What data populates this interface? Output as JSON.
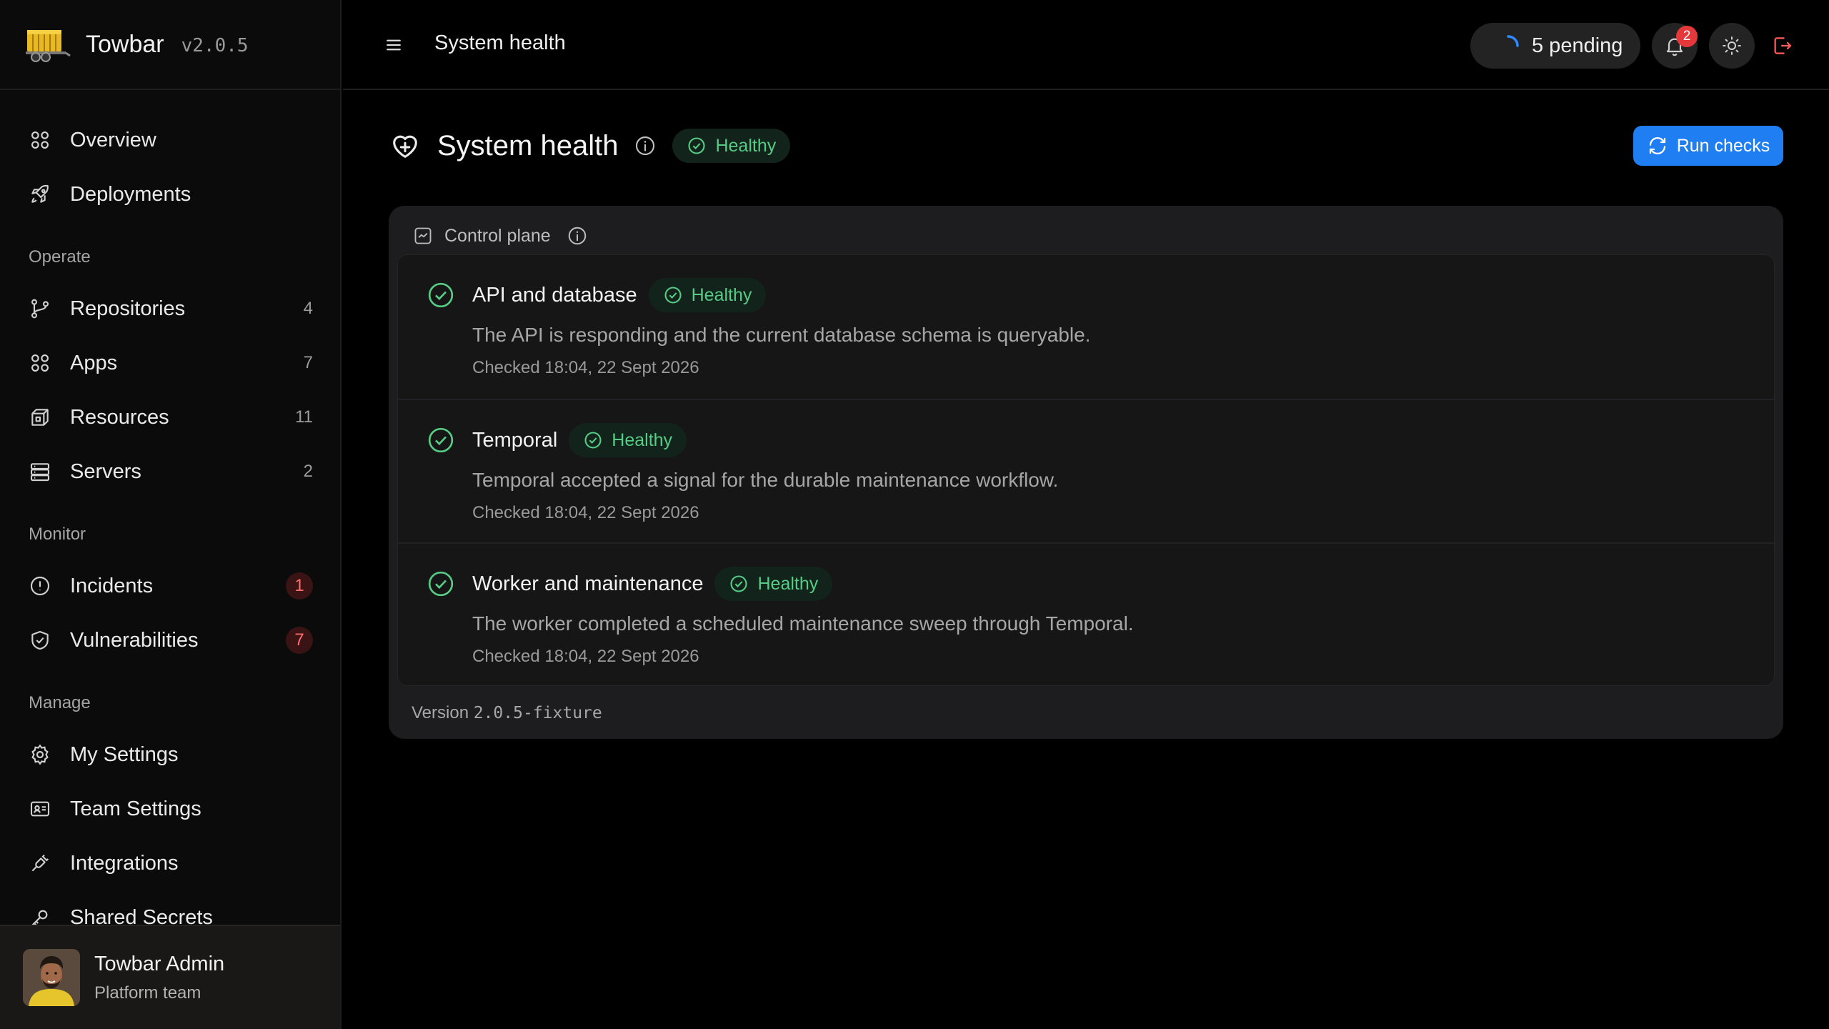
{
  "app": {
    "name": "Towbar",
    "version": "v2.0.5"
  },
  "sidebar": {
    "top_items": [
      {
        "label": "Overview",
        "icon": "grid-icon"
      },
      {
        "label": "Deployments",
        "icon": "rocket-icon"
      }
    ],
    "sections": [
      {
        "title": "Operate",
        "items": [
          {
            "label": "Repositories",
            "count": "4",
            "icon": "git-branch-icon"
          },
          {
            "label": "Apps",
            "count": "7",
            "icon": "grid-icon"
          },
          {
            "label": "Resources",
            "count": "11",
            "icon": "box-icon"
          },
          {
            "label": "Servers",
            "count": "2",
            "icon": "server-icon"
          }
        ]
      },
      {
        "title": "Monitor",
        "items": [
          {
            "label": "Incidents",
            "count": "1",
            "icon": "alert-circle-icon"
          },
          {
            "label": "Vulnerabilities",
            "count": "7",
            "icon": "shield-check-icon"
          }
        ]
      },
      {
        "title": "Manage",
        "items": [
          {
            "label": "My Settings",
            "icon": "gear-icon"
          },
          {
            "label": "Team Settings",
            "icon": "id-card-icon"
          },
          {
            "label": "Integrations",
            "icon": "plug-icon"
          },
          {
            "label": "Shared Secrets",
            "icon": "key-icon"
          }
        ]
      }
    ],
    "user": {
      "name": "Towbar Admin",
      "team": "Platform team"
    }
  },
  "topbar": {
    "title": "System health",
    "pending_label": "5 pending",
    "notifications_count": "2"
  },
  "page": {
    "title": "System health",
    "status": "Healthy",
    "run_button": "Run checks",
    "panel_title": "Control plane",
    "checks": [
      {
        "name": "API and database",
        "status": "Healthy",
        "description": "The API is responding and the current database schema is queryable.",
        "checked": "Checked 18:04, 22 Sept 2026"
      },
      {
        "name": "Temporal",
        "status": "Healthy",
        "description": "Temporal accepted a signal for the durable maintenance workflow.",
        "checked": "Checked 18:04, 22 Sept 2026"
      },
      {
        "name": "Worker and maintenance",
        "status": "Healthy",
        "description": "The worker completed a scheduled maintenance sweep through Temporal.",
        "checked": "Checked 18:04, 22 Sept 2026"
      }
    ],
    "version_label": "Version",
    "version_value": "2.0.5-fixture"
  },
  "colors": {
    "accent": "#1e7ef2",
    "healthy": "#56cc85",
    "danger": "#e5383b"
  }
}
